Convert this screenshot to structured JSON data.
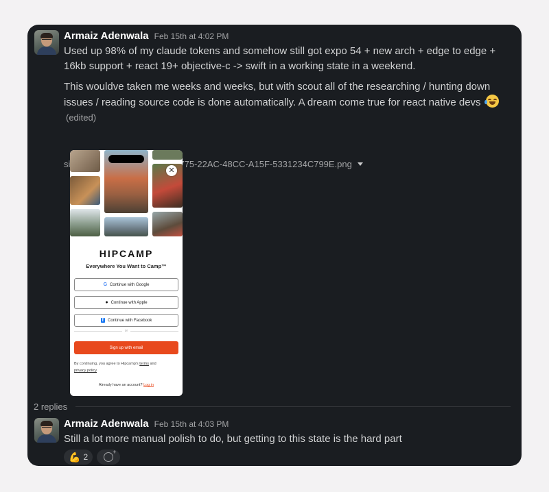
{
  "message1": {
    "author": "Armaiz Adenwala",
    "time": "Feb 15th at 4:02 PM",
    "paragraph1": "Used up 98% of my claude tokens and somehow still got expo 54 + new arch + edge to edge + 16kb support + react 19+ objective-c -> swift  in a working state in a weekend.",
    "paragraph2": "This wouldve taken me weeks and weeks, but with scout all of the researching / hunting down issues / reading source code is done automatically. A dream come true for react native devs",
    "emoji": "joy-emoji",
    "edited": "(edited)",
    "attachment_name": "simulator_screenshot_957E0775-22AC-48CC-A15F-5331234C799E.png"
  },
  "phone": {
    "logo": "HIPCAMP",
    "tagline": "Everywhere You Want to Camp™",
    "google_label": "Continue with Google",
    "apple_label": "Continue with Apple",
    "facebook_label": "Continue with Facebook",
    "or": "or",
    "signup_label": "Sign up with email",
    "terms_prefix": "By continuing, you agree to Hipcamp's",
    "terms_link": "terms",
    "terms_and": "and",
    "privacy_link": "privacy policy",
    "already": "Already have an account?",
    "login_link": "Log in",
    "brand_color": "#e8491d"
  },
  "thread": {
    "replies_label": "2 replies"
  },
  "message2": {
    "author": "Armaiz Adenwala",
    "time": "Feb 15th at 4:03 PM",
    "text": "Still a lot more manual polish to do, but getting to this state is the hard part"
  },
  "reactions": [
    {
      "emoji": "💪",
      "count": "2"
    }
  ],
  "colors": {
    "page_bg": "#f3f2f3",
    "card_bg": "#1a1d21",
    "text": "#d1d2d3",
    "muted": "#a3a4a6"
  }
}
